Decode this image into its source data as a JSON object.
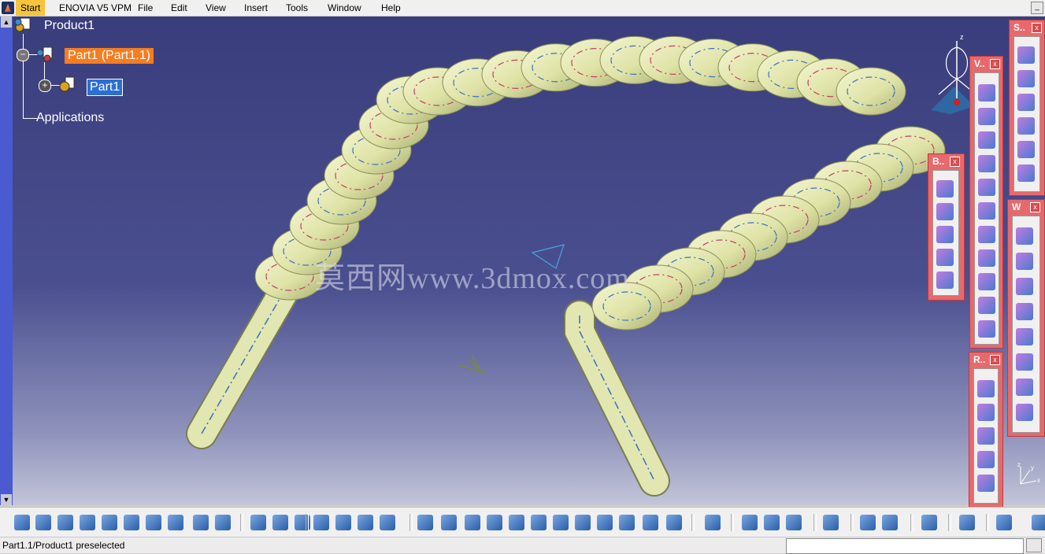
{
  "app": {
    "menu": {
      "start": "Start",
      "items": [
        "ENOVIA V5 VPM",
        "File",
        "Edit",
        "View",
        "Insert",
        "Tools",
        "Window",
        "Help"
      ]
    },
    "window_control": "_"
  },
  "tree": {
    "root": "Product1",
    "part_instance": "Part1 (Part1.1)",
    "part": "Part1",
    "applications": "Applications"
  },
  "watermark": "莫西网www.3dmox.com",
  "panels": {
    "sketch": {
      "title": "S..",
      "close": "x"
    },
    "views": {
      "title": "V..",
      "close": "x"
    },
    "boolean": {
      "title": "B..",
      "close": "x"
    },
    "wireframe": {
      "title": "W",
      "close": "x"
    },
    "replication": {
      "title": "R..",
      "close": "x"
    }
  },
  "compass": {
    "axis_x": "x",
    "axis_y": "y",
    "axis_z": "z"
  },
  "status": {
    "message": "Part1.1/Product1 preselected",
    "command_input": ""
  },
  "colors": {
    "viewport_top": "#3a3d7c",
    "viewport_bottom": "#c3c5d8",
    "coil": "#e6e9b4",
    "panel_border": "#e8696c",
    "highlight_orange": "#f57d1f",
    "highlight_blue": "#2a6ed6"
  }
}
